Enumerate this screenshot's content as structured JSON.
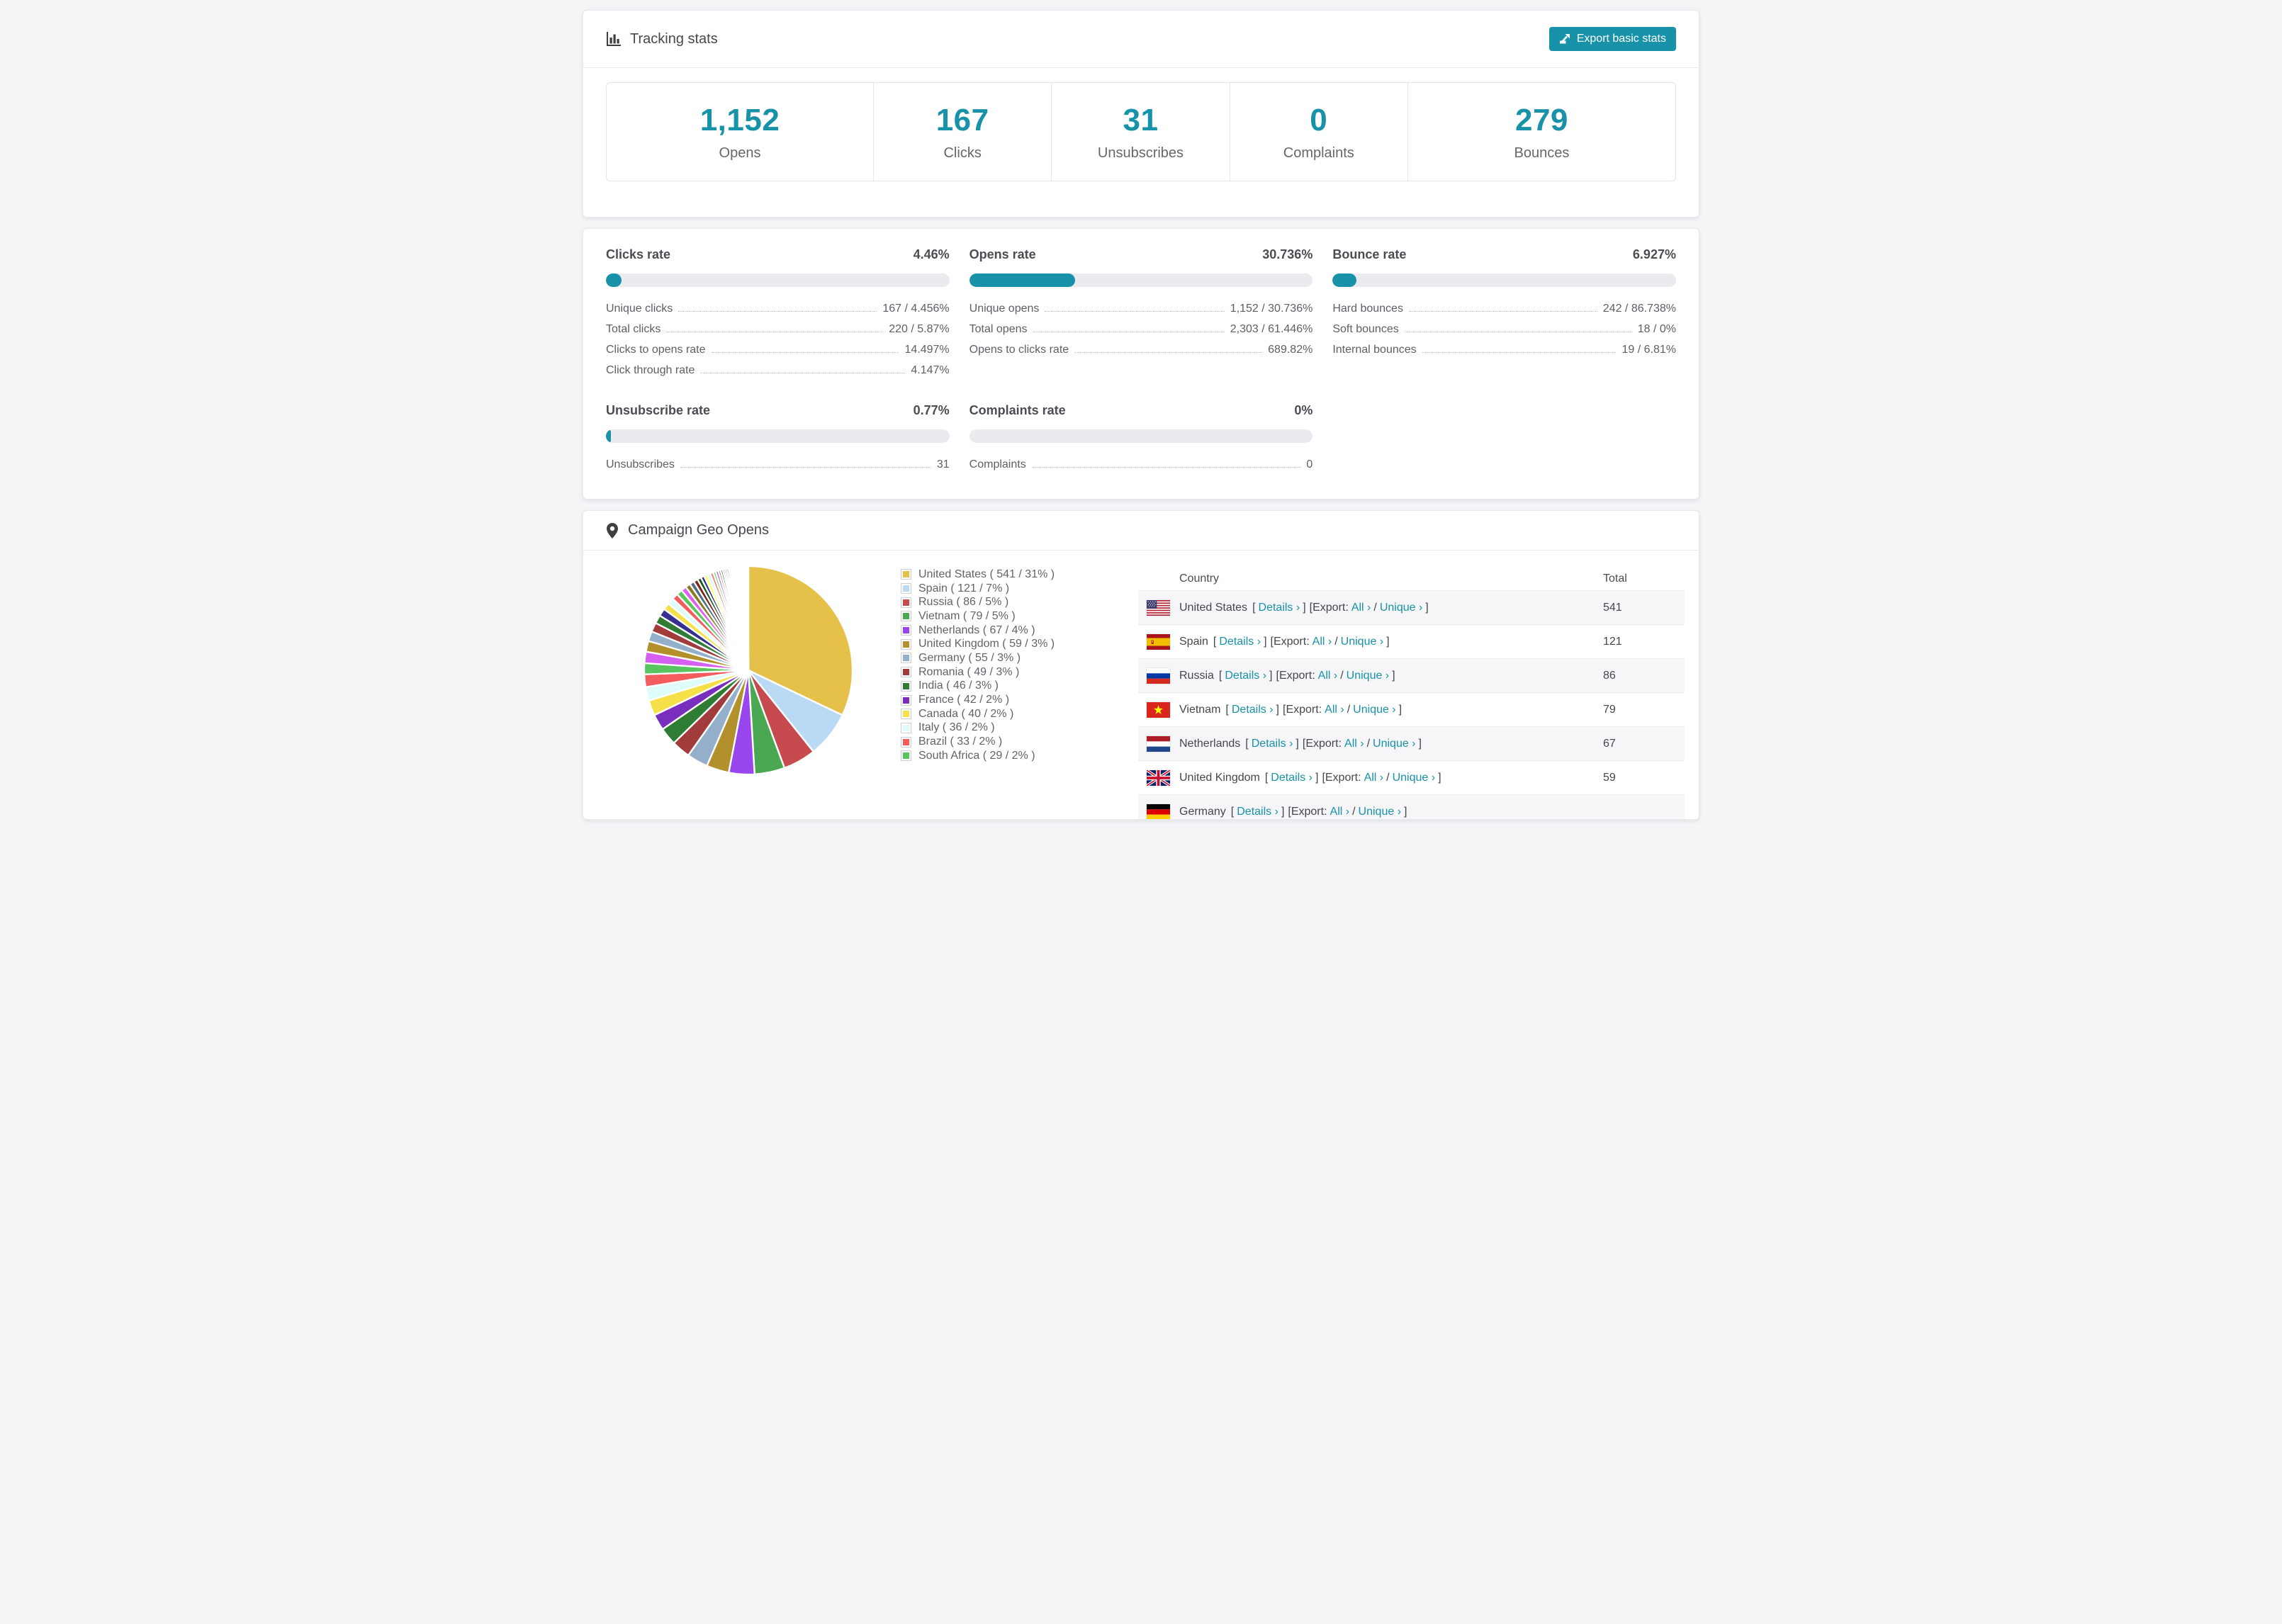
{
  "colors": {
    "accent": "#1792a8",
    "track": "#e9ebef",
    "title_text": "#45484d",
    "label_text": "#64686d"
  },
  "header": {
    "title": "Tracking stats",
    "export_label": "Export basic stats"
  },
  "stats": {
    "items": [
      {
        "value": "1,152",
        "label": "Opens"
      },
      {
        "value": "167",
        "label": "Clicks"
      },
      {
        "value": "31",
        "label": "Unsubscribes"
      },
      {
        "value": "0",
        "label": "Complaints"
      },
      {
        "value": "279",
        "label": "Bounces"
      }
    ]
  },
  "rates": {
    "clicks": {
      "title": "Clicks rate",
      "value": "4.46%",
      "bar_pct": 4.46,
      "rows": [
        {
          "label": "Unique clicks",
          "value": "167 / 4.456%"
        },
        {
          "label": "Total clicks",
          "value": "220 / 5.87%"
        },
        {
          "label": "Clicks to opens rate",
          "value": "14.497%"
        },
        {
          "label": "Click through rate",
          "value": "4.147%"
        }
      ]
    },
    "opens": {
      "title": "Opens rate",
      "value": "30.736%",
      "bar_pct": 30.736,
      "rows": [
        {
          "label": "Unique opens",
          "value": "1,152 / 30.736%"
        },
        {
          "label": "Total opens",
          "value": "2,303 / 61.446%"
        },
        {
          "label": "Opens to clicks rate",
          "value": "689.82%"
        }
      ]
    },
    "bounce": {
      "title": "Bounce rate",
      "value": "6.927%",
      "bar_pct": 6.927,
      "rows": [
        {
          "label": "Hard bounces",
          "value": "242 / 86.738%"
        },
        {
          "label": "Soft bounces",
          "value": "18 / 0%"
        },
        {
          "label": "Internal bounces",
          "value": "19 / 6.81%"
        }
      ]
    },
    "unsubscribe": {
      "title": "Unsubscribe rate",
      "value": "0.77%",
      "bar_pct": 0.77,
      "rows": [
        {
          "label": "Unsubscribes",
          "value": "31"
        }
      ]
    },
    "complaints": {
      "title": "Complaints rate",
      "value": "0%",
      "bar_pct": 0,
      "rows": [
        {
          "label": "Complaints",
          "value": "0"
        }
      ]
    }
  },
  "geo": {
    "title": "Campaign Geo Opens",
    "table": {
      "headers": {
        "country": "Country",
        "total": "Total"
      },
      "links": {
        "open": "[",
        "details": "Details ›",
        "close": "]",
        "export": "[Export:",
        "all": "All ›",
        "slash": "/",
        "unique": "Unique ›"
      },
      "rows": [
        {
          "country": "United States",
          "total": "541",
          "flag": "us"
        },
        {
          "country": "Spain",
          "total": "121",
          "flag": "es"
        },
        {
          "country": "Russia",
          "total": "86",
          "flag": "ru"
        },
        {
          "country": "Vietnam",
          "total": "79",
          "flag": "vn"
        },
        {
          "country": "Netherlands",
          "total": "67",
          "flag": "nl"
        },
        {
          "country": "United Kingdom",
          "total": "59",
          "flag": "gb"
        },
        {
          "country": "Germany",
          "total": "",
          "flag": "de"
        }
      ]
    }
  },
  "chart_data": {
    "type": "pie",
    "title": "Campaign Geo Opens",
    "legend_position": "right",
    "start_angle_deg": 0,
    "direction": "clockwise",
    "slices": [
      {
        "label": "United States",
        "value": 541,
        "pct": "31%",
        "color": "#E5C149",
        "legend": "United States ( 541 / 31% )"
      },
      {
        "label": "Spain",
        "value": 121,
        "pct": "7%",
        "color": "#B9D9F5",
        "legend": "Spain ( 121 / 7% )"
      },
      {
        "label": "Russia",
        "value": 86,
        "pct": "5%",
        "color": "#C64A4E",
        "legend": "Russia ( 86 / 5% )"
      },
      {
        "label": "Vietnam",
        "value": 79,
        "pct": "5%",
        "color": "#4AA852",
        "legend": "Vietnam ( 79 / 5% )"
      },
      {
        "label": "Netherlands",
        "value": 67,
        "pct": "4%",
        "color": "#9A46EE",
        "legend": "Netherlands ( 67 / 4% )"
      },
      {
        "label": "United Kingdom",
        "value": 59,
        "pct": "3%",
        "color": "#B2912D",
        "legend": "United Kingdom ( 59 / 3% )"
      },
      {
        "label": "Germany",
        "value": 55,
        "pct": "3%",
        "color": "#93AFC9",
        "legend": "Germany ( 55 / 3% )"
      },
      {
        "label": "Romania",
        "value": 49,
        "pct": "3%",
        "color": "#A23B3B",
        "legend": "Romania ( 49 / 3% )"
      },
      {
        "label": "India",
        "value": 46,
        "pct": "3%",
        "color": "#2F7D35",
        "legend": "India ( 46 / 3% )"
      },
      {
        "label": "France",
        "value": 42,
        "pct": "2%",
        "color": "#7A2EBE",
        "legend": "France ( 42 / 2% )"
      },
      {
        "label": "Canada",
        "value": 40,
        "pct": "2%",
        "color": "#F6E04A",
        "legend": "Canada ( 40 / 2% )"
      },
      {
        "label": "Italy",
        "value": 36,
        "pct": "2%",
        "color": "#DEFDFA",
        "legend": "Italy ( 36 / 2% )"
      },
      {
        "label": "Brazil",
        "value": 33,
        "pct": "2%",
        "color": "#F55C5E",
        "legend": "Brazil ( 33 / 2% )"
      },
      {
        "label": "South Africa",
        "value": 29,
        "pct": "2%",
        "color": "#58C55F",
        "legend": "South Africa ( 29 / 2% )"
      }
    ],
    "others_values": [
      30,
      28,
      26,
      24,
      22,
      20,
      18,
      17,
      16,
      15,
      14,
      13,
      12,
      11,
      10,
      9,
      9,
      8,
      8,
      7,
      7,
      6,
      6,
      5,
      5,
      5,
      4,
      4,
      4,
      3,
      3,
      3,
      3,
      2,
      2,
      2,
      2,
      2,
      2,
      2,
      1,
      1,
      1,
      1,
      1,
      1,
      1,
      1,
      1,
      1,
      1,
      1,
      1,
      1
    ],
    "others_palette": [
      "#D45FF0",
      "#B2912D",
      "#93AFC9",
      "#A23B3B",
      "#2F7D35",
      "#37308F",
      "#F6E04A",
      "#DEFDFA",
      "#F55C5E",
      "#58C55F",
      "#E05FF0",
      "#8A7B22",
      "#4F6F80",
      "#7E2222",
      "#1A5A20",
      "#2B2B8F",
      "#FFFF55",
      "#CCFBFF",
      "#FF7070",
      "#66DD66",
      "#CC55FF",
      "#998822",
      "#557788",
      "#883333",
      "#226622",
      "#5533AA",
      "#EEDD44",
      "#BBEEFF",
      "#EE5555",
      "#44BB55",
      "#DD44EE",
      "#AA9933",
      "#6688AA",
      "#994444",
      "#338833",
      "#6644BB",
      "#DDCC55",
      "#AADDEE",
      "#DD6666",
      "#55CC66"
    ]
  }
}
